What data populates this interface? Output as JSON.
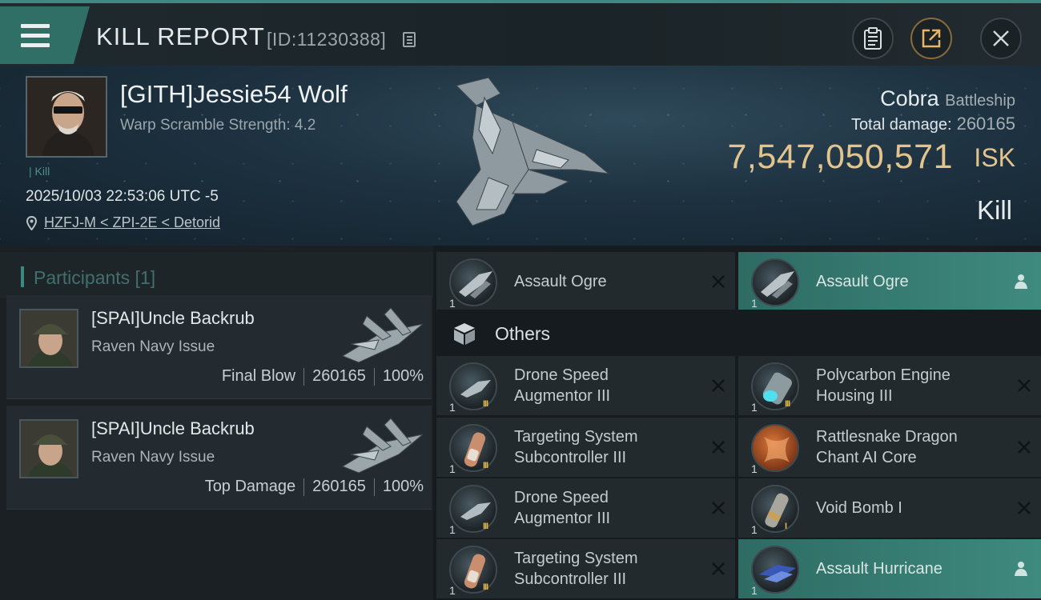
{
  "header": {
    "title": "KILL REPORT",
    "report_id": "[ID:11230388]"
  },
  "victim": {
    "name": "[GITH]Jessie54 Wolf",
    "scramble": "Warp Scramble Strength: 4.2",
    "tag": "| Kill",
    "timestamp": "2025/10/03 22:53:06 UTC -5",
    "location": "HZFJ-M < ZPI-2E < Detorid",
    "ship_name": "Cobra",
    "ship_class": "Battleship",
    "total_damage_label": "Total damage:",
    "total_damage": "260165",
    "isk_value": "7,547,050,571",
    "isk_label": "ISK",
    "outcome": "Kill"
  },
  "participants": {
    "heading": "Participants [1]",
    "items": [
      {
        "name": "[SPAI]Uncle Backrub",
        "ship": "Raven Navy Issue",
        "role": "Final Blow",
        "damage": "260165",
        "percent": "100%"
      },
      {
        "name": "[SPAI]Uncle Backrub",
        "ship": "Raven Navy Issue",
        "role": "Top Damage",
        "damage": "260165",
        "percent": "100%"
      }
    ]
  },
  "items": {
    "drones_row": [
      {
        "qty": "1",
        "name": "Assault Ogre",
        "state": "destroyed"
      },
      {
        "qty": "1",
        "name": "Assault Ogre",
        "state": "dropped"
      }
    ],
    "others_label": "Others",
    "others": [
      {
        "qty": "1",
        "tier": "III",
        "name_1": "Drone Speed",
        "name_2": "Augmentor III",
        "state": "destroyed"
      },
      {
        "qty": "1",
        "tier": "III",
        "name_1": "Polycarbon Engine",
        "name_2": "Housing III",
        "state": "destroyed"
      },
      {
        "qty": "1",
        "tier": "III",
        "name_1": "Targeting System",
        "name_2": "Subcontroller III",
        "state": "destroyed"
      },
      {
        "qty": "1",
        "tier": "",
        "name_1": "Rattlesnake Dragon",
        "name_2": "Chant AI Core",
        "state": "destroyed"
      },
      {
        "qty": "1",
        "tier": "III",
        "name_1": "Drone Speed",
        "name_2": "Augmentor III",
        "state": "destroyed"
      },
      {
        "qty": "1",
        "tier": "I",
        "name_1": "Void Bomb I",
        "name_2": "",
        "state": "destroyed"
      },
      {
        "qty": "1",
        "tier": "III",
        "name_1": "Targeting System",
        "name_2": "Subcontroller III",
        "state": "destroyed"
      },
      {
        "qty": "1",
        "tier": "",
        "name_1": "Assault Hurricane",
        "name_2": "",
        "state": "dropped"
      }
    ]
  },
  "colors": {
    "accent_teal": "#3f8a7f",
    "isk_gold": "#e3c48e",
    "tier_gold": "#e0b54a"
  },
  "icons": [
    "menu-icon",
    "copy-icon",
    "clipboard-icon",
    "share-icon",
    "close-icon",
    "location-pin-icon",
    "box-icon",
    "remove-x-icon",
    "pilot-icon"
  ]
}
